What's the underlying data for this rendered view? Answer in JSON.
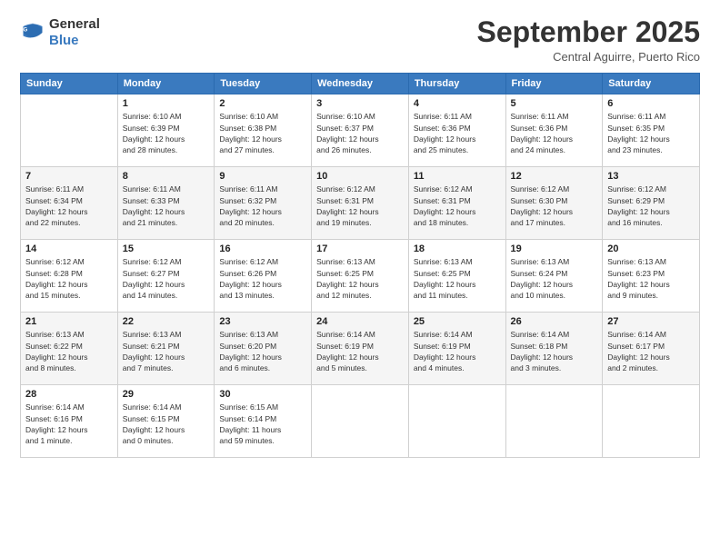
{
  "logo": {
    "line1": "General",
    "line2": "Blue"
  },
  "header": {
    "month": "September 2025",
    "location": "Central Aguirre, Puerto Rico"
  },
  "weekdays": [
    "Sunday",
    "Monday",
    "Tuesday",
    "Wednesday",
    "Thursday",
    "Friday",
    "Saturday"
  ],
  "weeks": [
    [
      {
        "day": "",
        "info": ""
      },
      {
        "day": "1",
        "info": "Sunrise: 6:10 AM\nSunset: 6:39 PM\nDaylight: 12 hours\nand 28 minutes."
      },
      {
        "day": "2",
        "info": "Sunrise: 6:10 AM\nSunset: 6:38 PM\nDaylight: 12 hours\nand 27 minutes."
      },
      {
        "day": "3",
        "info": "Sunrise: 6:10 AM\nSunset: 6:37 PM\nDaylight: 12 hours\nand 26 minutes."
      },
      {
        "day": "4",
        "info": "Sunrise: 6:11 AM\nSunset: 6:36 PM\nDaylight: 12 hours\nand 25 minutes."
      },
      {
        "day": "5",
        "info": "Sunrise: 6:11 AM\nSunset: 6:36 PM\nDaylight: 12 hours\nand 24 minutes."
      },
      {
        "day": "6",
        "info": "Sunrise: 6:11 AM\nSunset: 6:35 PM\nDaylight: 12 hours\nand 23 minutes."
      }
    ],
    [
      {
        "day": "7",
        "info": "Sunrise: 6:11 AM\nSunset: 6:34 PM\nDaylight: 12 hours\nand 22 minutes."
      },
      {
        "day": "8",
        "info": "Sunrise: 6:11 AM\nSunset: 6:33 PM\nDaylight: 12 hours\nand 21 minutes."
      },
      {
        "day": "9",
        "info": "Sunrise: 6:11 AM\nSunset: 6:32 PM\nDaylight: 12 hours\nand 20 minutes."
      },
      {
        "day": "10",
        "info": "Sunrise: 6:12 AM\nSunset: 6:31 PM\nDaylight: 12 hours\nand 19 minutes."
      },
      {
        "day": "11",
        "info": "Sunrise: 6:12 AM\nSunset: 6:31 PM\nDaylight: 12 hours\nand 18 minutes."
      },
      {
        "day": "12",
        "info": "Sunrise: 6:12 AM\nSunset: 6:30 PM\nDaylight: 12 hours\nand 17 minutes."
      },
      {
        "day": "13",
        "info": "Sunrise: 6:12 AM\nSunset: 6:29 PM\nDaylight: 12 hours\nand 16 minutes."
      }
    ],
    [
      {
        "day": "14",
        "info": "Sunrise: 6:12 AM\nSunset: 6:28 PM\nDaylight: 12 hours\nand 15 minutes."
      },
      {
        "day": "15",
        "info": "Sunrise: 6:12 AM\nSunset: 6:27 PM\nDaylight: 12 hours\nand 14 minutes."
      },
      {
        "day": "16",
        "info": "Sunrise: 6:12 AM\nSunset: 6:26 PM\nDaylight: 12 hours\nand 13 minutes."
      },
      {
        "day": "17",
        "info": "Sunrise: 6:13 AM\nSunset: 6:25 PM\nDaylight: 12 hours\nand 12 minutes."
      },
      {
        "day": "18",
        "info": "Sunrise: 6:13 AM\nSunset: 6:25 PM\nDaylight: 12 hours\nand 11 minutes."
      },
      {
        "day": "19",
        "info": "Sunrise: 6:13 AM\nSunset: 6:24 PM\nDaylight: 12 hours\nand 10 minutes."
      },
      {
        "day": "20",
        "info": "Sunrise: 6:13 AM\nSunset: 6:23 PM\nDaylight: 12 hours\nand 9 minutes."
      }
    ],
    [
      {
        "day": "21",
        "info": "Sunrise: 6:13 AM\nSunset: 6:22 PM\nDaylight: 12 hours\nand 8 minutes."
      },
      {
        "day": "22",
        "info": "Sunrise: 6:13 AM\nSunset: 6:21 PM\nDaylight: 12 hours\nand 7 minutes."
      },
      {
        "day": "23",
        "info": "Sunrise: 6:13 AM\nSunset: 6:20 PM\nDaylight: 12 hours\nand 6 minutes."
      },
      {
        "day": "24",
        "info": "Sunrise: 6:14 AM\nSunset: 6:19 PM\nDaylight: 12 hours\nand 5 minutes."
      },
      {
        "day": "25",
        "info": "Sunrise: 6:14 AM\nSunset: 6:19 PM\nDaylight: 12 hours\nand 4 minutes."
      },
      {
        "day": "26",
        "info": "Sunrise: 6:14 AM\nSunset: 6:18 PM\nDaylight: 12 hours\nand 3 minutes."
      },
      {
        "day": "27",
        "info": "Sunrise: 6:14 AM\nSunset: 6:17 PM\nDaylight: 12 hours\nand 2 minutes."
      }
    ],
    [
      {
        "day": "28",
        "info": "Sunrise: 6:14 AM\nSunset: 6:16 PM\nDaylight: 12 hours\nand 1 minute."
      },
      {
        "day": "29",
        "info": "Sunrise: 6:14 AM\nSunset: 6:15 PM\nDaylight: 12 hours\nand 0 minutes."
      },
      {
        "day": "30",
        "info": "Sunrise: 6:15 AM\nSunset: 6:14 PM\nDaylight: 11 hours\nand 59 minutes."
      },
      {
        "day": "",
        "info": ""
      },
      {
        "day": "",
        "info": ""
      },
      {
        "day": "",
        "info": ""
      },
      {
        "day": "",
        "info": ""
      }
    ]
  ]
}
